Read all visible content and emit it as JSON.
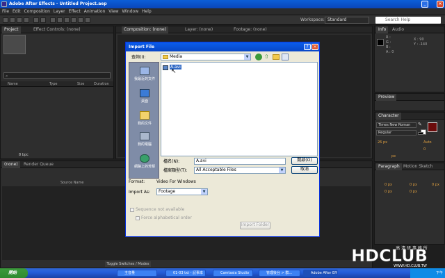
{
  "window": {
    "title": "Adobe After Effects - Untitled Project.aep",
    "min": "_",
    "max": "□",
    "close": "×"
  },
  "menu": [
    "File",
    "Edit",
    "Composition",
    "Layer",
    "Effect",
    "Animation",
    "View",
    "Window",
    "Help"
  ],
  "workspace": {
    "label": "Workspace:",
    "value": "Standard",
    "search_placeholder": "Search Help"
  },
  "project_panel": {
    "tabs": [
      "Project",
      "Effect Controls: (none)"
    ],
    "columns": [
      "Name",
      "Type",
      "Size",
      "Duration"
    ],
    "bpc": "8 bpc"
  },
  "comp_panel": {
    "tabs": [
      "Composition: (none)",
      "Layer: (none)",
      "Footage: (none)"
    ]
  },
  "info_panel": {
    "tabs": [
      "Info",
      "Audio"
    ],
    "r": "R :",
    "g": "G :",
    "b": "B :",
    "a": "A : 0",
    "x": "X : 90",
    "y": "Y : -140"
  },
  "preview_panel": {
    "title": "Preview"
  },
  "character_panel": {
    "title": "Character",
    "font": "Times New Roman",
    "style": "Regular",
    "size": "26 px",
    "leading": "Auto",
    "tracking": "0",
    "kerning": "px"
  },
  "paragraph_panel": {
    "tabs": [
      "Paragraph",
      "Motion Sketch"
    ],
    "values": [
      "0 px",
      "0 px",
      "0 px",
      "0 px",
      "0 px"
    ]
  },
  "timeline": {
    "tabs": [
      "(none)",
      "Render Queue"
    ],
    "source_header": "Source Name",
    "toggle": "Toggle Switches / Modes"
  },
  "dialog": {
    "title": "Import File",
    "lookin_label": "查詢(I):",
    "lookin_value": "Media",
    "places": [
      "我最近的文件",
      "桌面",
      "我的文件",
      "我的電腦",
      "網路上的芳鄰"
    ],
    "file_selected": "A.avi",
    "filename_label": "檔名(N):",
    "filename_value": "A.avi",
    "filetype_label": "檔案類型(T):",
    "filetype_value": "All Acceptable Files",
    "open_btn": "開啟(O)",
    "cancel_btn": "取消",
    "format_label": "Format:",
    "format_value": "Video For Windows",
    "importas_label": "Import As:",
    "importas_value": "Footage",
    "seq_label": "Sequence not available",
    "alpha_label": "Force alphabetical order",
    "import_folder": "Import Folder"
  },
  "taskbar": {
    "start": "開始",
    "tasks": [
      "主音量",
      "01-03 txt - 記事本",
      "Camtasia Studio",
      "管理後台 > 群...",
      "Adobe After Effe..."
    ],
    "clock": "下午"
  },
  "logo": {
    "text": "HDCLUB",
    "cn": "高 清 研 事 務 所",
    "url": "WWW.HD.CLUB.TW"
  }
}
